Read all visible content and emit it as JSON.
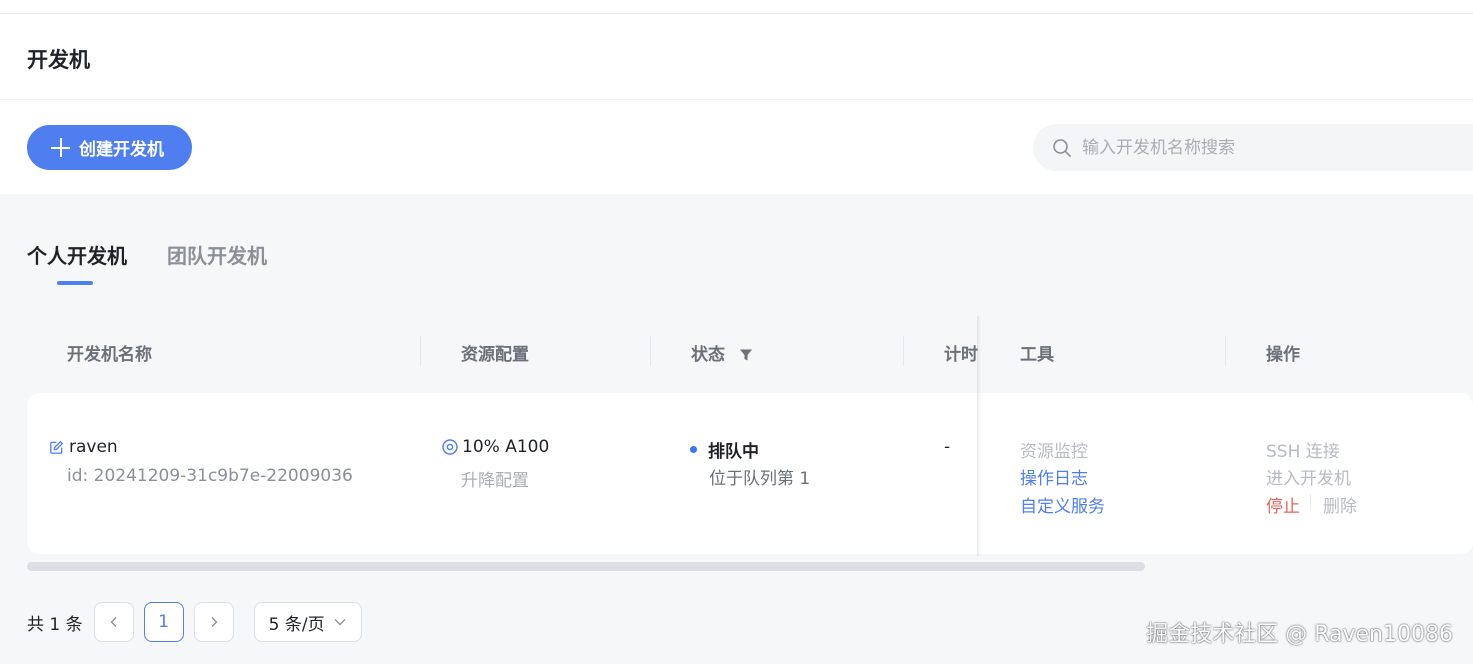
{
  "header": {
    "title": "开发机"
  },
  "toolbar": {
    "create_label": "创建开发机"
  },
  "search": {
    "placeholder": "输入开发机名称搜索"
  },
  "tabs": [
    {
      "label": "个人开发机",
      "active": true
    },
    {
      "label": "团队开发机",
      "active": false
    }
  ],
  "table": {
    "columns": [
      "开发机名称",
      "资源配置",
      "状态",
      "计时",
      "工具",
      "操作"
    ],
    "rows": [
      {
        "name": "raven",
        "id": "id: 20241209-31c9b7e-22009036",
        "resource": "10% A100",
        "resource_action": "升降配置",
        "status": "排队中",
        "status_detail": "位于队列第 1",
        "timer": "-",
        "tools": [
          "资源监控",
          "操作日志",
          "自定义服务"
        ],
        "actions": [
          "SSH 连接",
          "进入开发机",
          "停止",
          "删除"
        ]
      }
    ]
  },
  "pagination": {
    "total": "共 1 条",
    "current_page": "1",
    "page_size": "5 条/页"
  },
  "watermark": "掘金技术社区 @ Raven10086",
  "colors": {
    "accent": "#4f7ef0",
    "danger": "#e5645a",
    "status_dot": "#3478f6"
  }
}
